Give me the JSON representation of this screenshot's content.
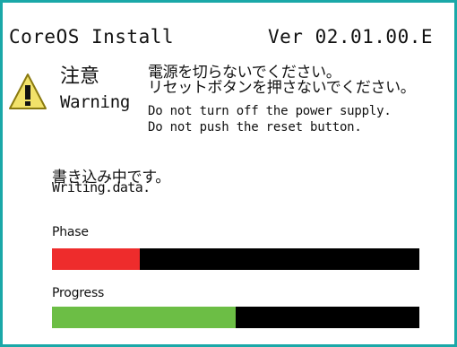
{
  "header": {
    "title": "CoreOS Install",
    "version": "Ver 02.01.00.E"
  },
  "warning": {
    "icon": "warning-icon",
    "label_jp": "注意",
    "label_en": "Warning",
    "messages": [
      "電源を切らないでください。",
      "リセットボタンを押さないでください。",
      "Do not turn off the power supply.",
      "Do not push the reset button."
    ]
  },
  "status": {
    "text_jp": "書き込み中です。",
    "text_en": "Writing.data."
  },
  "bars": {
    "phase": {
      "label": "Phase",
      "fraction": 0.24,
      "fill_color": "#ee2c2c",
      "track_color": "#000000"
    },
    "progress": {
      "label": "Progress",
      "fraction": 0.5,
      "fill_color": "#6cbe45",
      "track_color": "#000000"
    }
  },
  "colors": {
    "border": "#1aa8a8",
    "background": "#ffffff",
    "text": "#111111",
    "warning_icon_fill": "#f2e26a"
  }
}
